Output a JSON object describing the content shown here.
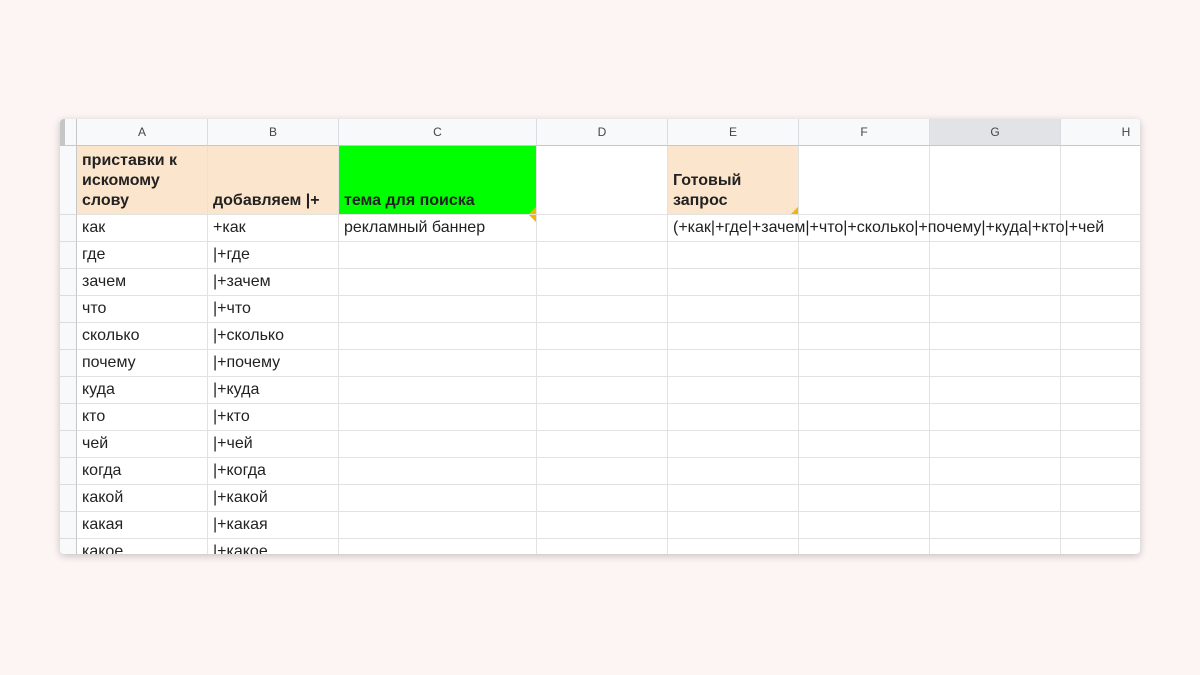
{
  "columns": [
    "A",
    "B",
    "C",
    "D",
    "E",
    "F",
    "G",
    "H"
  ],
  "header_row": {
    "a": "приставки к искомому слову",
    "b": "добавляем |+",
    "c": "тема для поиска",
    "e": "Готовый запрос"
  },
  "colors": {
    "peach": "#fce5cd",
    "green": "#00ff00",
    "page_background": "#fcf5f4"
  },
  "rows": [
    {
      "a": "как",
      "b": "+как",
      "c": "рекламный баннер",
      "e": "(+как|+где|+зачем|+что|+сколько|+почему|+куда|+кто|+чей"
    },
    {
      "a": "где",
      "b": "|+где"
    },
    {
      "a": "зачем",
      "b": "|+зачем"
    },
    {
      "a": "что",
      "b": "|+что"
    },
    {
      "a": "сколько",
      "b": "|+сколько"
    },
    {
      "a": "почему",
      "b": "|+почему"
    },
    {
      "a": "куда",
      "b": "|+куда"
    },
    {
      "a": "кто",
      "b": "|+кто"
    },
    {
      "a": "чей",
      "b": "|+чей"
    },
    {
      "a": "когда",
      "b": "|+когда"
    },
    {
      "a": "какой",
      "b": "|+какой"
    },
    {
      "a": "какая",
      "b": "|+какая"
    },
    {
      "a": "какое",
      "b": "|+какое"
    }
  ],
  "selected_column": "G"
}
